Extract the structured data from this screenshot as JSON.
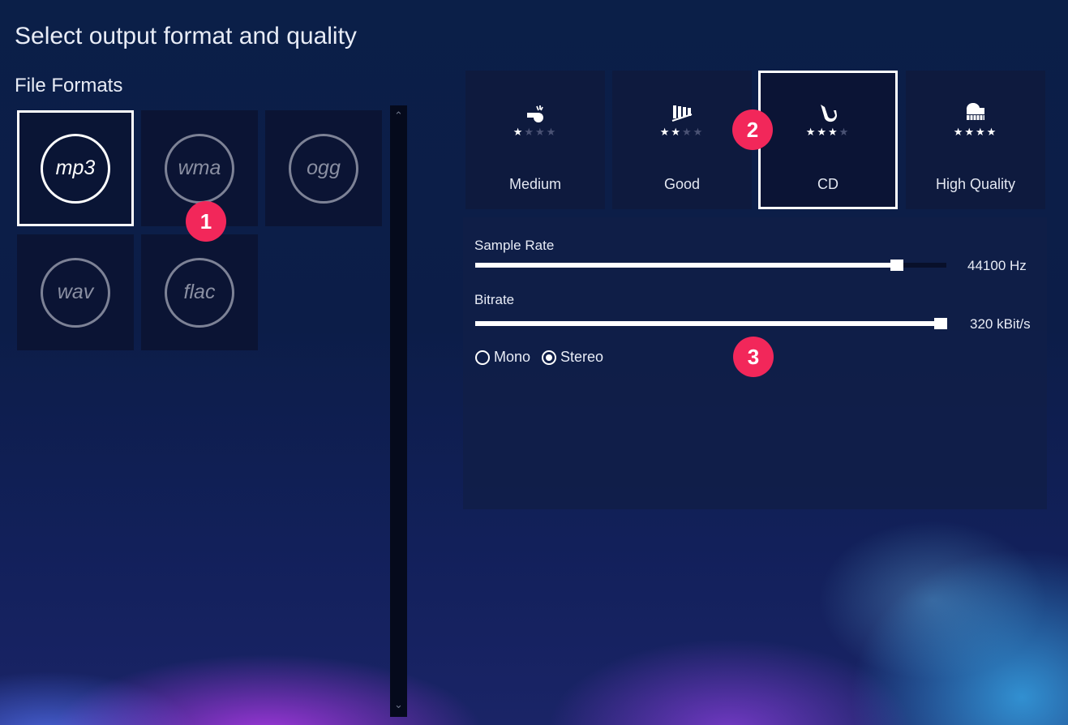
{
  "title": "Select output format and quality",
  "file_formats": {
    "heading": "File Formats",
    "items": [
      {
        "label": "mp3",
        "selected": true
      },
      {
        "label": "wma",
        "selected": false
      },
      {
        "label": "ogg",
        "selected": false
      },
      {
        "label": "wav",
        "selected": false
      },
      {
        "label": "flac",
        "selected": false
      }
    ]
  },
  "quality": {
    "presets": [
      {
        "label": "Medium",
        "icon": "whistle-icon",
        "stars": 1,
        "max_stars": 4,
        "selected": false
      },
      {
        "label": "Good",
        "icon": "xylophone-icon",
        "stars": 2,
        "max_stars": 4,
        "selected": false
      },
      {
        "label": "CD",
        "icon": "saxophone-icon",
        "stars": 3,
        "max_stars": 4,
        "selected": true
      },
      {
        "label": "High Quality",
        "icon": "piano-icon",
        "stars": 4,
        "max_stars": 4,
        "selected": false
      }
    ]
  },
  "settings": {
    "sample_rate": {
      "label": "Sample Rate",
      "value": "44100 Hz",
      "level": 0.89
    },
    "bitrate": {
      "label": "Bitrate",
      "value": "320 kBit/s",
      "level": 1.0
    },
    "channels": {
      "options": [
        "Mono",
        "Stereo"
      ],
      "selected": "Stereo"
    }
  },
  "badges": [
    "1",
    "2",
    "3"
  ],
  "colors": {
    "accent_badge": "#f2275a",
    "selected_border": "#ffffff"
  }
}
